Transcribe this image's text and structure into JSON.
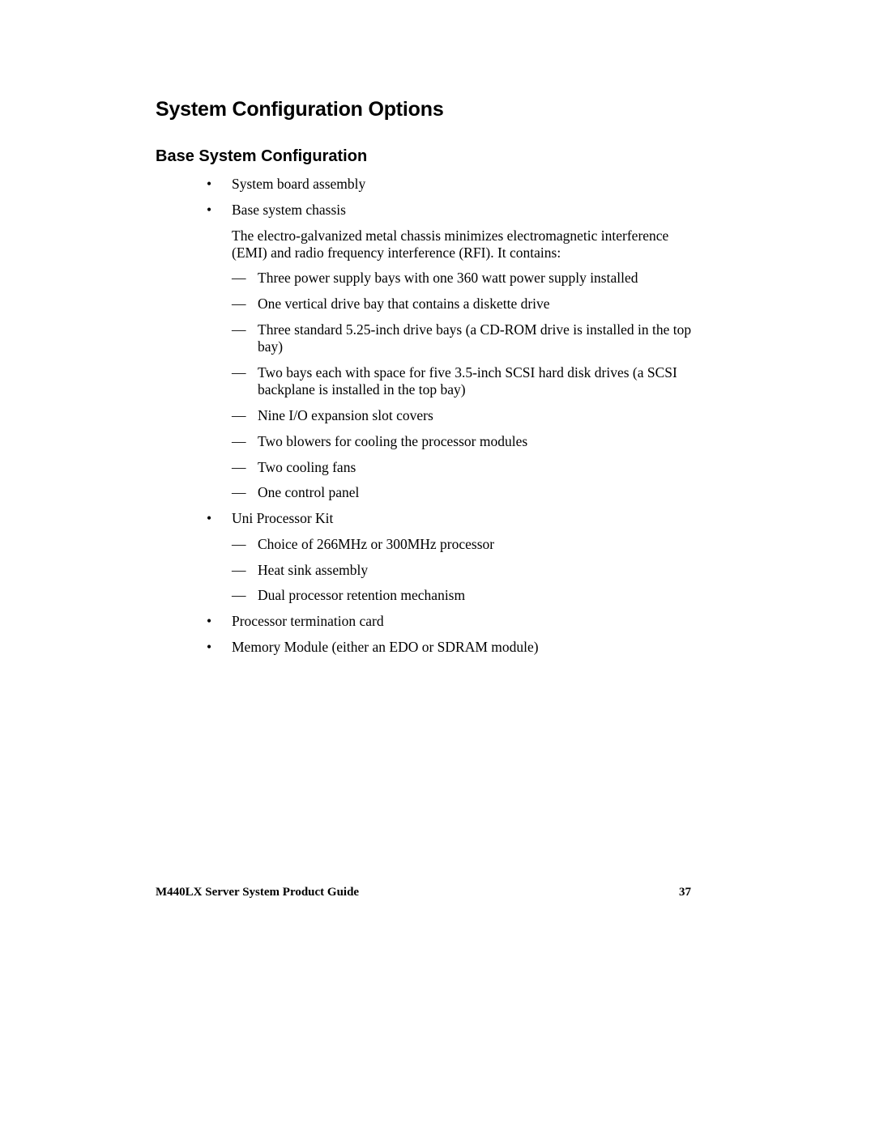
{
  "document": {
    "title": "System Configuration Options",
    "section_title": "Base System Configuration",
    "bullet_glyph": "•",
    "dash_glyph": "—",
    "items": {
      "system_board": "System board assembly",
      "base_chassis": "Base system chassis",
      "chassis_description": "The electro-galvanized metal chassis minimizes electromagnetic interference (EMI) and radio frequency interference (RFI).  It contains:",
      "chassis_contents": [
        "Three power supply bays with one 360 watt power supply installed",
        "One vertical drive bay that contains a diskette drive",
        "Three standard 5.25-inch drive bays (a CD-ROM drive is installed in the top bay)",
        "Two bays each with space for five 3.5-inch SCSI hard disk drives (a SCSI backplane is installed in the top bay)",
        "Nine I/O expansion slot covers",
        "Two blowers for cooling the processor modules",
        "Two cooling fans",
        "One control panel"
      ],
      "uni_processor_kit": "Uni Processor Kit",
      "processor_kit_contents": [
        "Choice of 266MHz or 300MHz processor",
        "Heat sink assembly",
        "Dual processor retention mechanism"
      ],
      "termination_card": "Processor termination card",
      "memory_module": "Memory Module (either an EDO or SDRAM module)"
    }
  },
  "footer": {
    "guide_title": "M440LX Server System Product Guide",
    "page_number": "37"
  }
}
